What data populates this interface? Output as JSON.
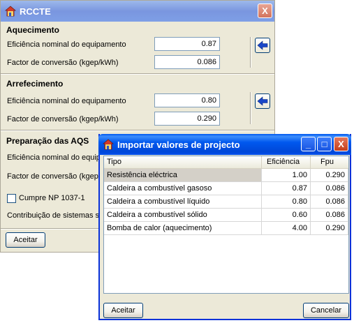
{
  "main_window": {
    "title": "RCCTE",
    "close_label": "X",
    "sections": {
      "aquecimento": {
        "heading": "Aquecimento",
        "eficiencia_label": "Eficiência nominal do equipamento",
        "eficiencia_value": "0.87",
        "factor_label": "Factor de conversão (kgep/kWh)",
        "factor_value": "0.086"
      },
      "arrefecimento": {
        "heading": "Arrefecimento",
        "eficiencia_label": "Eficiência nominal do equipamento",
        "eficiencia_value": "0.80",
        "factor_label": "Factor de conversão (kgep/kWh)",
        "factor_value": "0.290"
      },
      "aqs": {
        "heading": "Preparação das AQS",
        "eficiencia_label": "Eficiência nominal do equipamento",
        "factor_label": "Factor de conversão (kgep/kWh)"
      }
    },
    "cumpre_label": "Cumpre NP 1037-1",
    "contribuicao_label": "Contribuição de sistemas solares",
    "aceitar_label": "Aceitar",
    "import_icon": "arrow-left-icon"
  },
  "dialog": {
    "title": "Importar valores de projecto",
    "controls": {
      "minimize": "_",
      "maximize": "□",
      "close": "X"
    },
    "columns": [
      "Tipo",
      "Eficiência",
      "Fpu"
    ],
    "rows": [
      {
        "tipo": "Resistência eléctrica",
        "eficiencia": "1.00",
        "fpu": "0.290"
      },
      {
        "tipo": "Caldeira a combustível gasoso",
        "eficiencia": "0.87",
        "fpu": "0.086"
      },
      {
        "tipo": "Caldeira a combustível líquido",
        "eficiencia": "0.80",
        "fpu": "0.086"
      },
      {
        "tipo": "Caldeira a combustível sólido",
        "eficiencia": "0.60",
        "fpu": "0.086"
      },
      {
        "tipo": "Bomba de calor (aquecimento)",
        "eficiencia": "4.00",
        "fpu": "0.290"
      }
    ],
    "aceitar_label": "Aceitar",
    "cancelar_label": "Cancelar"
  },
  "colors": {
    "titlebar_active": "#0058ee",
    "titlebar_inactive": "#7a96df",
    "face": "#ece9d8",
    "arrow": "#1a47c8"
  }
}
